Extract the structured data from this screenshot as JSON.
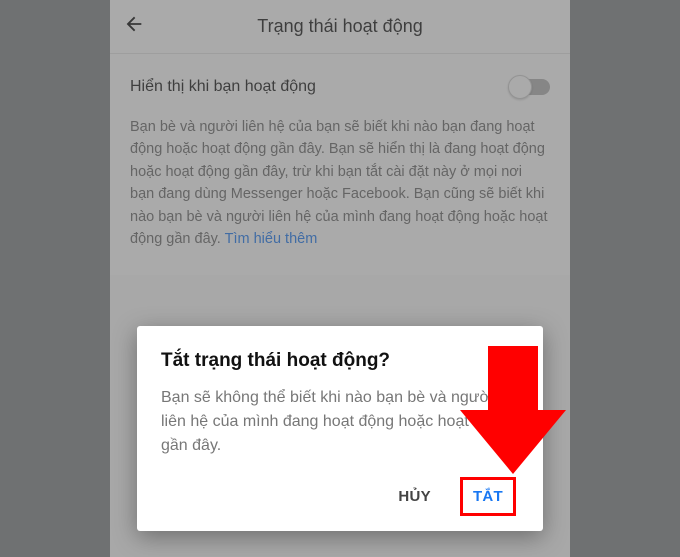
{
  "header": {
    "title": "Trạng thái hoạt động"
  },
  "setting": {
    "label": "Hiển thị khi bạn hoạt động",
    "toggle_on": false
  },
  "description": {
    "text": "Bạn bè và người liên hệ của bạn sẽ biết khi nào bạn đang hoạt động hoặc hoạt động gần đây. Bạn sẽ hiển thị là đang hoạt động hoặc hoạt động gần đây, trừ khi bạn tắt cài đặt này ở mọi nơi bạn đang dùng Messenger hoặc Facebook. Bạn cũng sẽ biết khi nào bạn bè và người liên hệ của mình đang hoạt động hoặc hoạt động gần đây. ",
    "link_label": "Tìm hiểu thêm"
  },
  "dialog": {
    "title": "Tắt trạng thái hoạt động?",
    "body": "Bạn sẽ không thể biết khi nào bạn bè và người liên hệ của mình đang hoạt động hoặc hoạt động gần đây.",
    "cancel_label": "HỦY",
    "confirm_label": "TẮT"
  },
  "annotation": {
    "highlight_target": "confirm-button",
    "highlight_color": "#ff0000",
    "arrow_color": "#ff0000"
  }
}
